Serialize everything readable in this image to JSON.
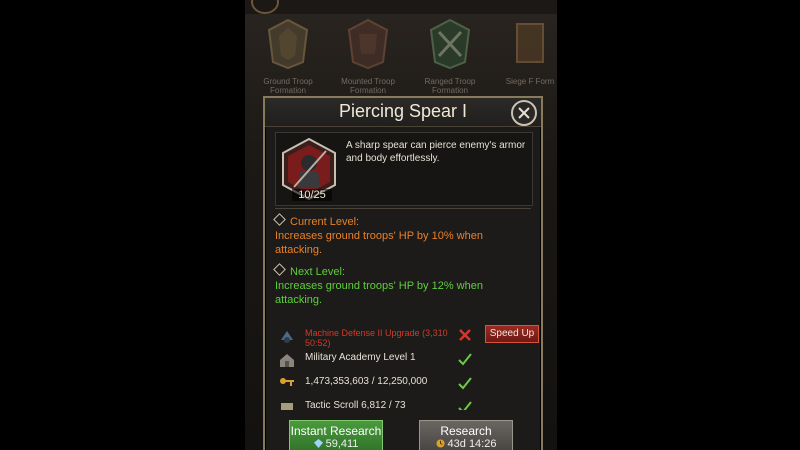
{
  "tree": {
    "nodes": [
      {
        "label": "Ground Troop Formation"
      },
      {
        "label": "Mounted Troop Formation"
      },
      {
        "label": "Ranged Troop Formation"
      },
      {
        "label": "Siege F Form"
      }
    ]
  },
  "dialog": {
    "title": "Piercing Spear I",
    "description": "A sharp spear can pierce enemy's armor and body effortlessly.",
    "level_progress": "10/25",
    "current_level": {
      "heading": "Current Level:",
      "text": "Increases ground troops' HP by 10% when attacking."
    },
    "next_level": {
      "heading": "Next Level:",
      "text": "Increases ground troops' HP by 12% when attacking."
    },
    "requirements": [
      {
        "text": "Machine Defense II Upgrade (3,310 50:52)",
        "met": false,
        "icon": "machine-icon",
        "action": "Speed Up"
      },
      {
        "text": "Military Academy Level 1",
        "met": true,
        "icon": "academy-icon"
      },
      {
        "text": "1,473,353,603 / 12,250,000",
        "met": true,
        "icon": "key-icon"
      },
      {
        "text": "Tactic Scroll 6,812 / 73",
        "met": true,
        "icon": "scroll-icon"
      }
    ],
    "buttons": {
      "instant_label": "Instant Research",
      "instant_cost": "59,411",
      "research_label": "Research",
      "research_time": "43d 14:26"
    }
  },
  "colors": {
    "current": "#e8812a",
    "next": "#5fce3c",
    "frame": "#8a7a5c",
    "speed_up": "#9b2a22"
  }
}
